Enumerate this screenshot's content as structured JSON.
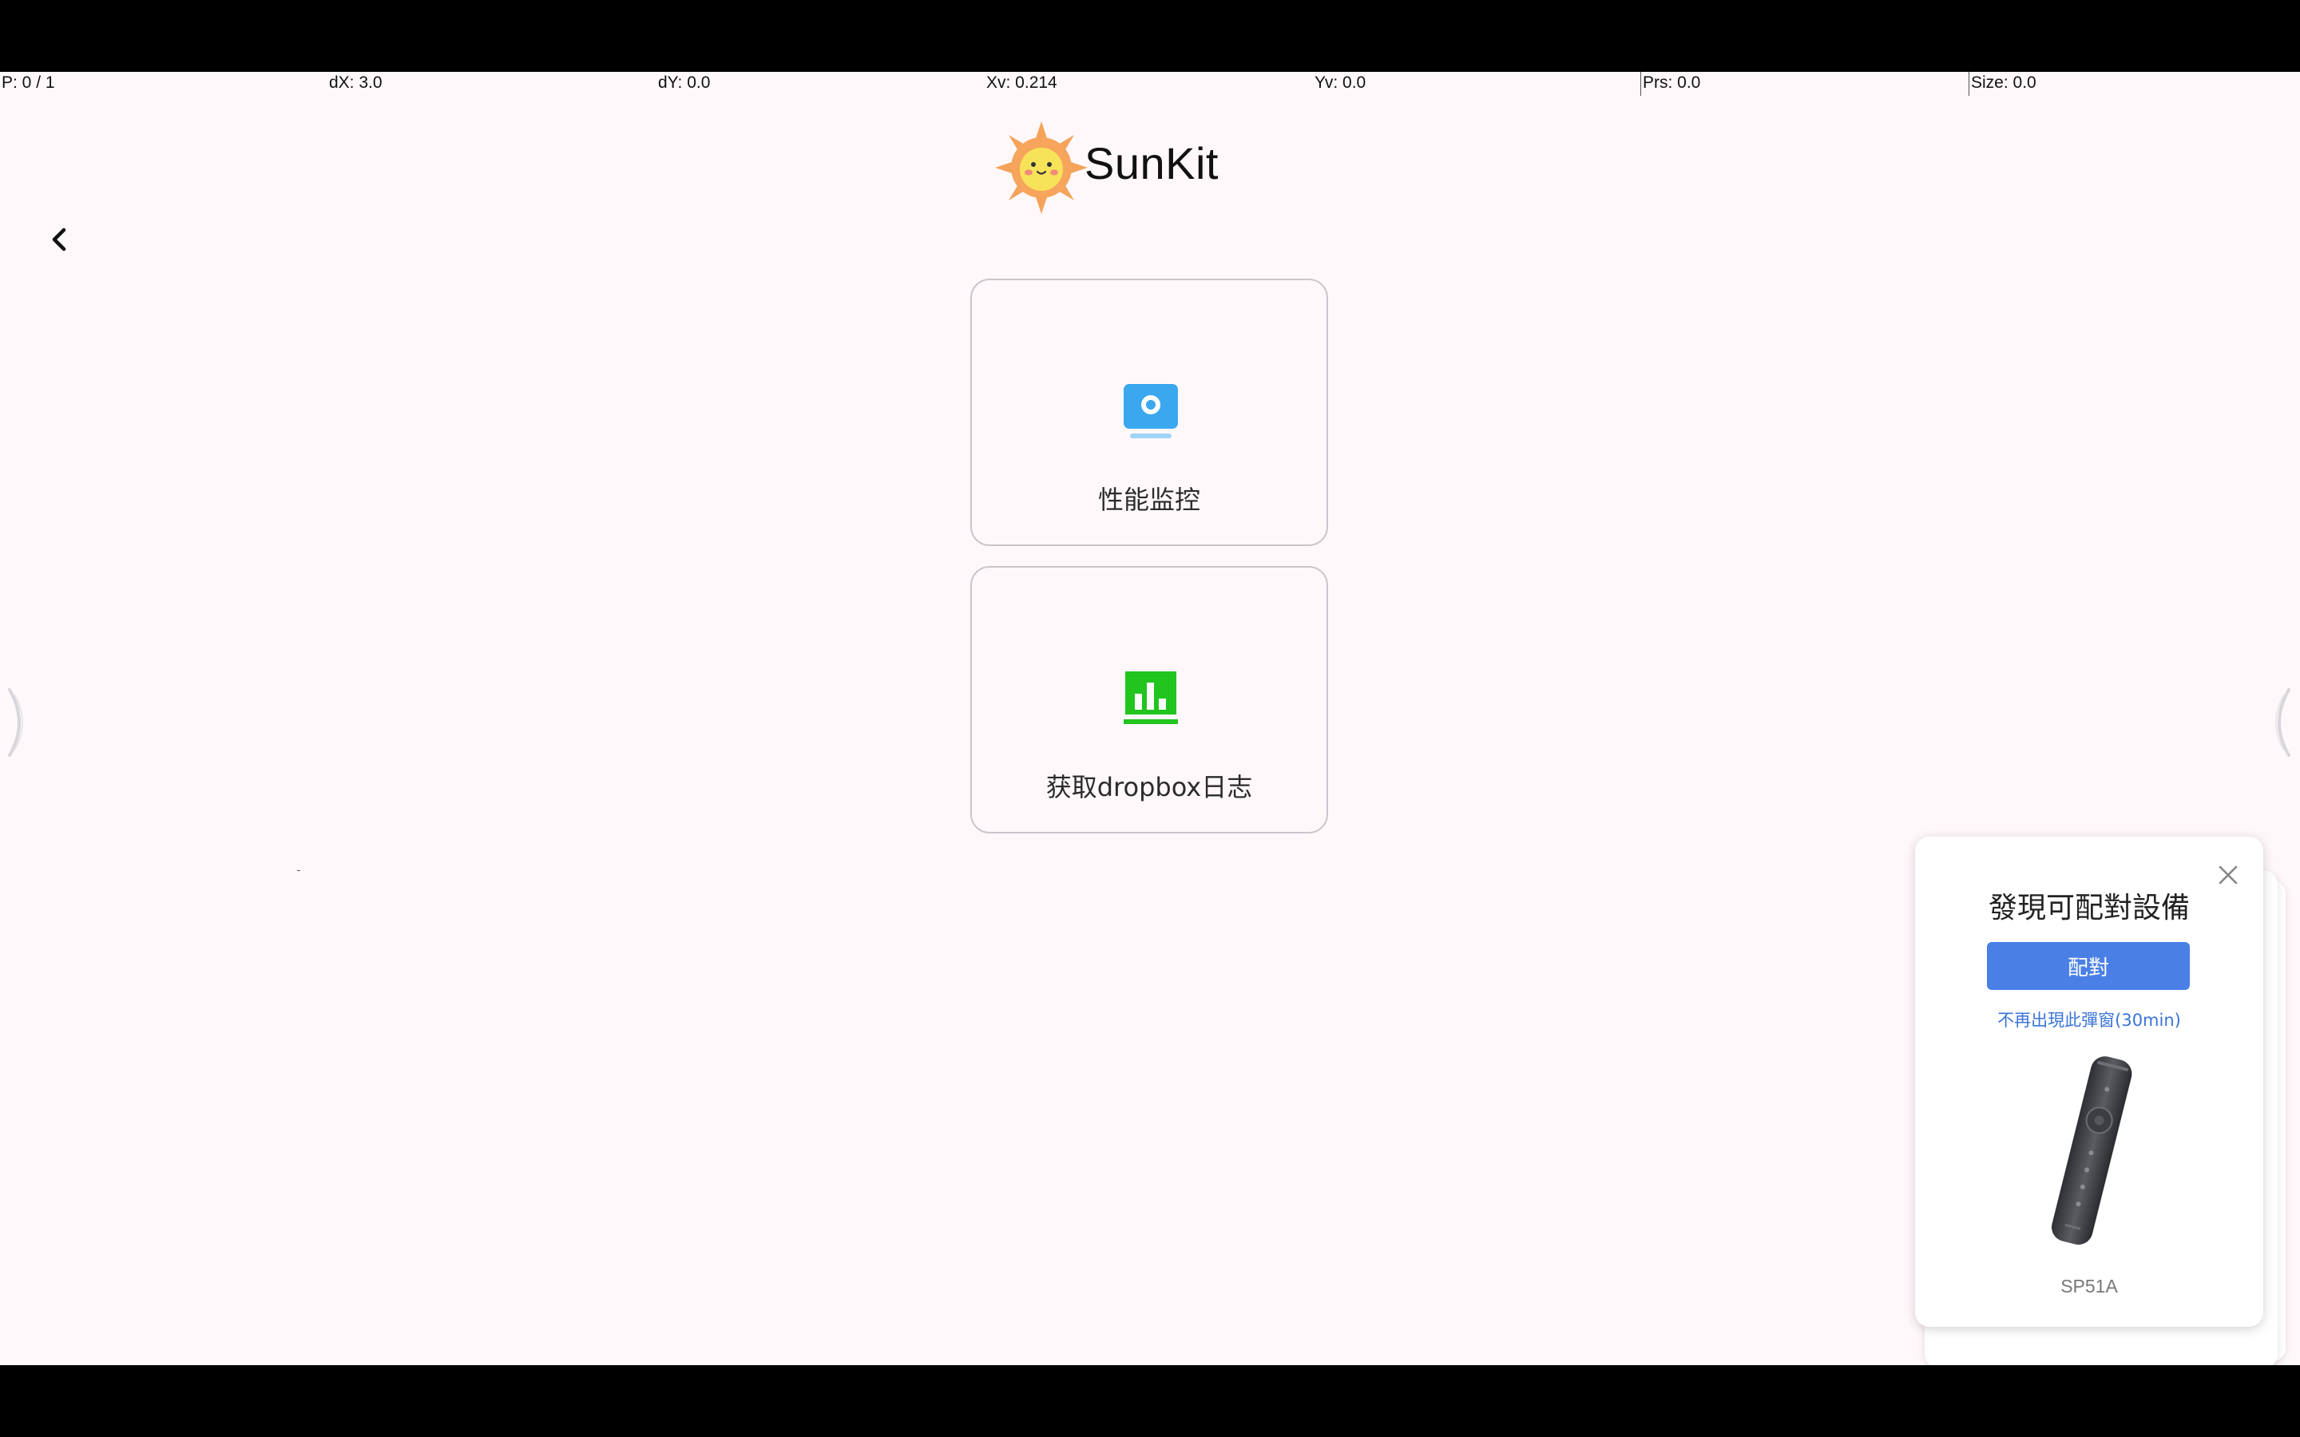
{
  "debug_bar": {
    "pointer": "P: 0 / 1",
    "dx": "dX: 3.0",
    "dy": "dY: 0.0",
    "xv": "Xv: 0.214",
    "yv": "Yv: 0.0",
    "prs": "Prs: 0.0",
    "size": "Size: 0.0"
  },
  "header": {
    "app_name": "SunKit",
    "logo_icon": "sun-mascot-icon",
    "back_icon": "chevron-left-icon"
  },
  "cards": [
    {
      "label": "性能监控",
      "icon": "monitor-eye-icon",
      "icon_color": "#3aa7ee"
    },
    {
      "label": "获取dropbox日志",
      "icon": "bar-chart-icon",
      "icon_color": "#22c41e"
    }
  ],
  "popup": {
    "title": "發現可配對設備",
    "pair_label": "配對",
    "dismiss_label": "不再出現此彈窗(30min)",
    "device_name": "SP51A",
    "device_icon": "remote-control-icon",
    "close_icon": "close-icon",
    "accent_color": "#4a7fe6"
  },
  "colors": {
    "background": "#fff8fb",
    "card_border": "#c9c6cc"
  }
}
